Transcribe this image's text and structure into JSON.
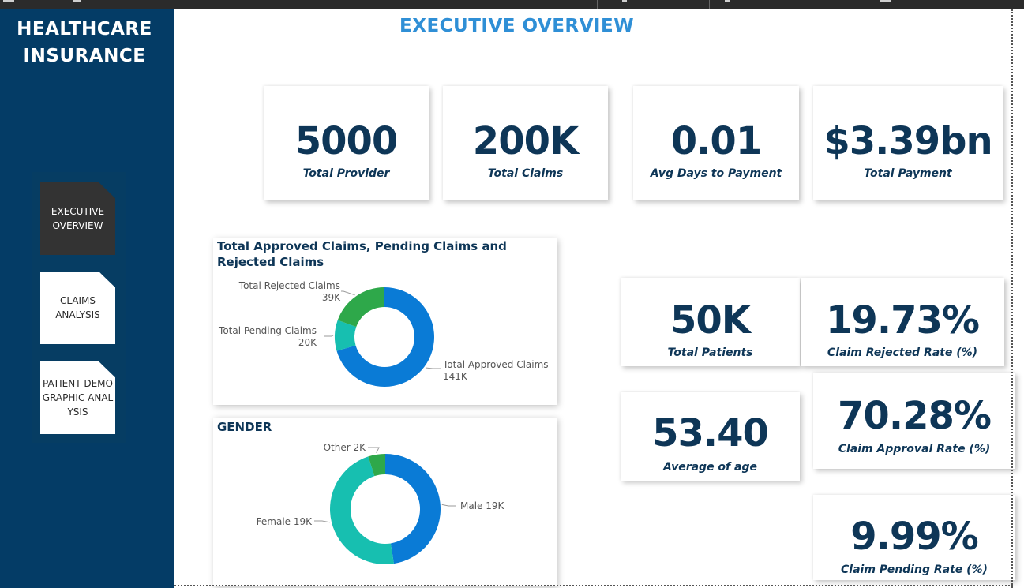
{
  "sidebar": {
    "title_line1": "HEALTHCARE",
    "title_line2": "INSURANCE",
    "nav": [
      {
        "label": "EXECUTIVE OVERVIEW",
        "active": true
      },
      {
        "label": "CLAIMS ANALYSIS",
        "active": false
      },
      {
        "label": "PATIENT DEMOGRAPHIC ANALYSIS",
        "active": false
      }
    ]
  },
  "page_title": "EXECUTIVE OVERVIEW",
  "kpis": {
    "total_provider": {
      "value": "5000",
      "label": "Total Provider"
    },
    "total_claims": {
      "value": "200K",
      "label": "Total Claims"
    },
    "avg_days": {
      "value": "0.01",
      "label": "Avg Days to Payment"
    },
    "total_payment": {
      "value": "$3.39bn",
      "label": "Total Payment"
    },
    "total_patients": {
      "value": "50K",
      "label": "Total Patients"
    },
    "rejected_rate": {
      "value": "19.73%",
      "label": "Claim Rejected Rate (%)"
    },
    "avg_age": {
      "value": "53.40",
      "label": "Average of age"
    },
    "approval_rate": {
      "value": "70.28%",
      "label": "Claim Approval Rate (%)"
    },
    "pending_rate": {
      "value": "9.99%",
      "label": "Claim Pending Rate (%)"
    }
  },
  "colors": {
    "sidebar": "#043c66",
    "title": "#2f8fd6",
    "kpi_text": "#0e3657",
    "blue": "#0a7bd6",
    "teal": "#17bfb0",
    "green": "#2ea84a"
  },
  "chart_data": [
    {
      "type": "pie",
      "title": "Total Approved Claims, Pending Claims and Rejected Claims",
      "slices": [
        {
          "name": "Total Approved Claims",
          "value": 141000,
          "display": "141K",
          "color": "#0a7bd6"
        },
        {
          "name": "Total Pending Claims",
          "value": 20000,
          "display": "20K",
          "color": "#17bfb0"
        },
        {
          "name": "Total Rejected Claims",
          "value": 39000,
          "display": "39K",
          "color": "#2ea84a"
        }
      ]
    },
    {
      "type": "pie",
      "title": "GENDER",
      "slices": [
        {
          "name": "Male",
          "value": 19000,
          "display": "19K",
          "color": "#0a7bd6"
        },
        {
          "name": "Female",
          "value": 19000,
          "display": "19K",
          "color": "#17bfb0"
        },
        {
          "name": "Other",
          "value": 2000,
          "display": "2K",
          "color": "#2ea84a"
        }
      ]
    }
  ]
}
